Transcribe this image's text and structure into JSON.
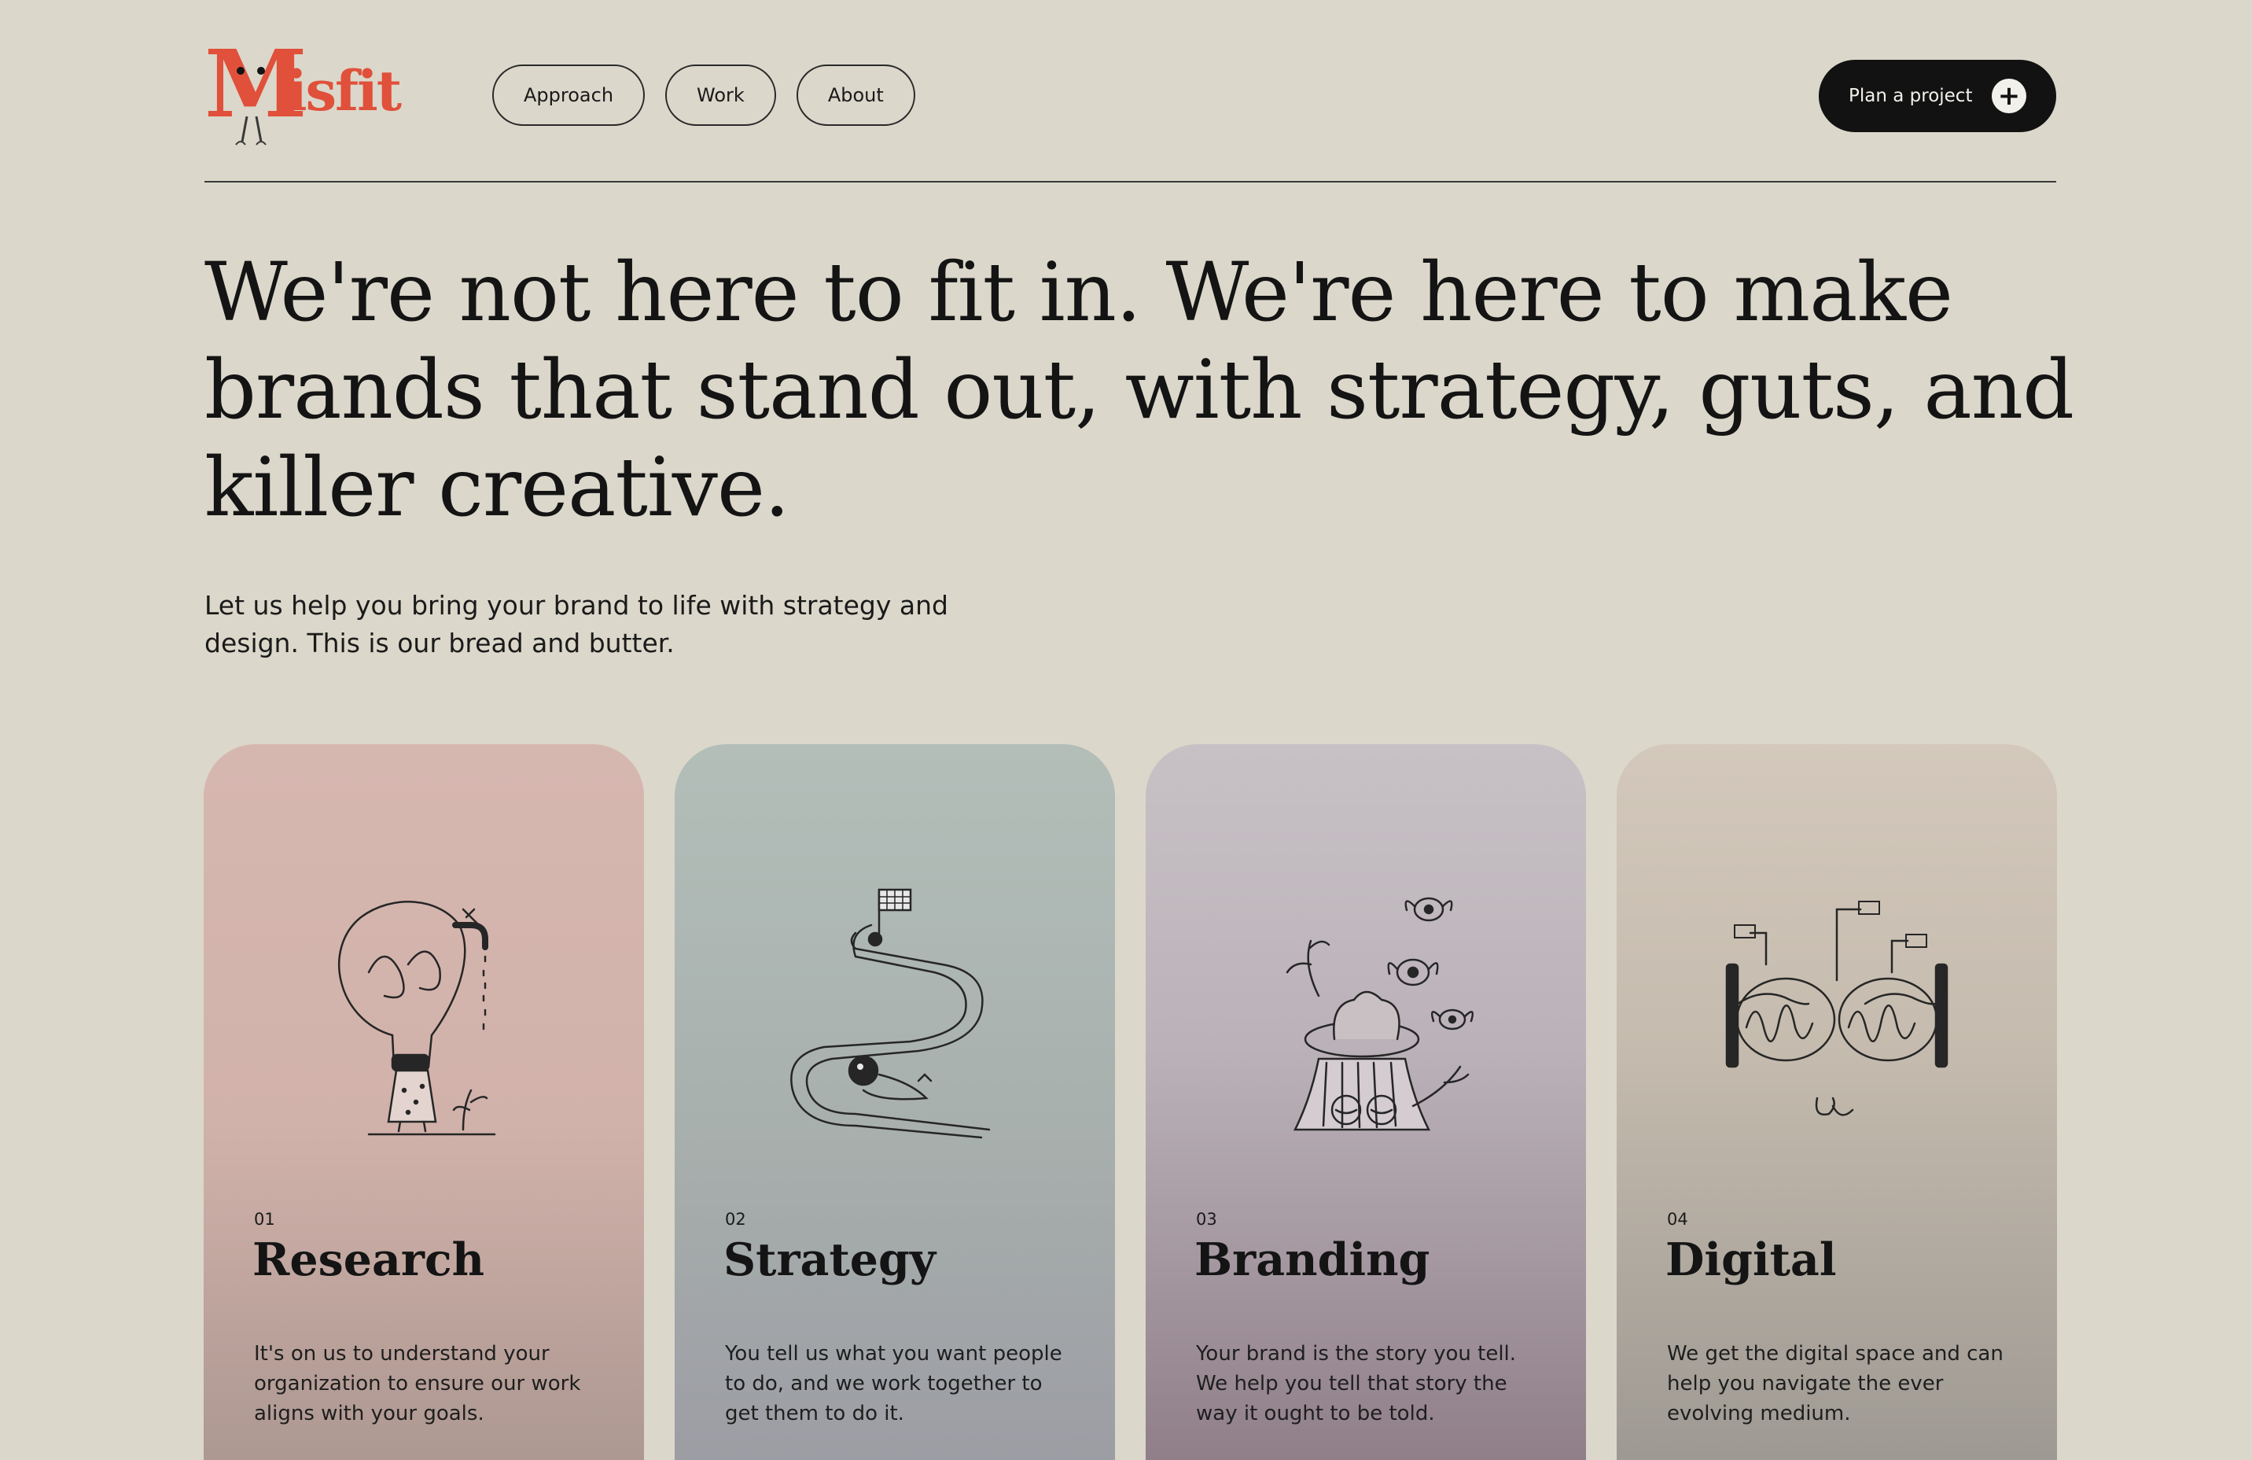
{
  "brand": {
    "logo_text": "Misfit",
    "logo_color": "#e0503a"
  },
  "nav": {
    "items": [
      {
        "label": "Approach"
      },
      {
        "label": "Work"
      },
      {
        "label": "About"
      }
    ],
    "cta_label": "Plan a project",
    "cta_icon": "plus-icon"
  },
  "hero": {
    "headline": "We're not here to fit in. We're here to make brands that stand out, with strategy, guts, and killer creative.",
    "subhead": "Let us help you bring your brand to life with strategy and design. This is our bread and butter."
  },
  "services": [
    {
      "number": "01",
      "title": "Research",
      "description": "It's on us to understand your organization to ensure our work aligns with your goals.",
      "illustration": "lightbulb-faucet-illustration"
    },
    {
      "number": "02",
      "title": "Strategy",
      "description": "You tell us what you want people to do, and we work together to get them to do it.",
      "illustration": "winding-road-flag-illustration"
    },
    {
      "number": "03",
      "title": "Branding",
      "description": "Your brand is the story you tell. We help you tell that story the way it ought to be told.",
      "illustration": "tree-hat-eyes-illustration"
    },
    {
      "number": "04",
      "title": "Digital",
      "description": "We get the digital space and can help you navigate the ever evolving medium.",
      "illustration": "glasses-screens-illustration"
    }
  ]
}
